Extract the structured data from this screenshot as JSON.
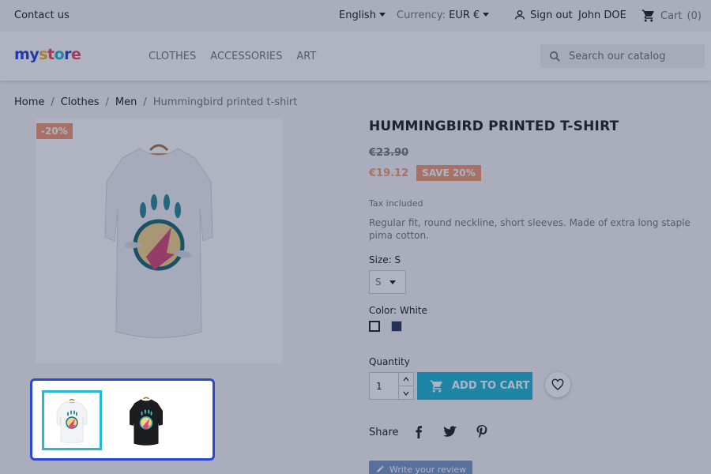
{
  "topbar": {
    "contact_label": "Contact us",
    "language": "English",
    "currency_label": "Currency:",
    "currency_value": "EUR €",
    "signout_label": "Sign out",
    "user_name": "John DOE",
    "cart_label": "Cart",
    "cart_count": "(0)"
  },
  "header": {
    "logo_text": [
      "m",
      "y",
      " ",
      "s",
      "t",
      "o",
      "r",
      "e"
    ],
    "nav": [
      "CLOTHES",
      "ACCESSORIES",
      "ART"
    ],
    "search_placeholder": "Search our catalog"
  },
  "breadcrumb": {
    "items": [
      "Home",
      "Clothes",
      "Men"
    ],
    "current": "Hummingbird printed t-shirt"
  },
  "gallery": {
    "discount_flag": "-20%"
  },
  "product": {
    "title": "HUMMINGBIRD PRINTED T-SHIRT",
    "old_price": "€23.90",
    "price": "€19.12",
    "save_badge": "SAVE 20%",
    "tax_label": "Tax included",
    "description": "Regular fit, round neckline, short sleeves. Made of extra long staple pima cotton.",
    "size_label": "Size: S",
    "size_value": "S",
    "color_label": "Color: White",
    "quantity_label": "Quantity",
    "quantity_value": "1",
    "add_to_cart_label": "ADD TO CART",
    "share_label": "Share",
    "review_label": "Write your review"
  },
  "colors": {
    "accent": "#24b9d7",
    "discount": "#f39d72",
    "highlight_border": "#2b47d6",
    "overlay": "#15214b"
  },
  "icons": [
    "user-icon",
    "cart-icon",
    "search-icon",
    "cart-add-icon",
    "heart-icon",
    "facebook-icon",
    "twitter-icon",
    "pinterest-icon",
    "pencil-icon"
  ]
}
